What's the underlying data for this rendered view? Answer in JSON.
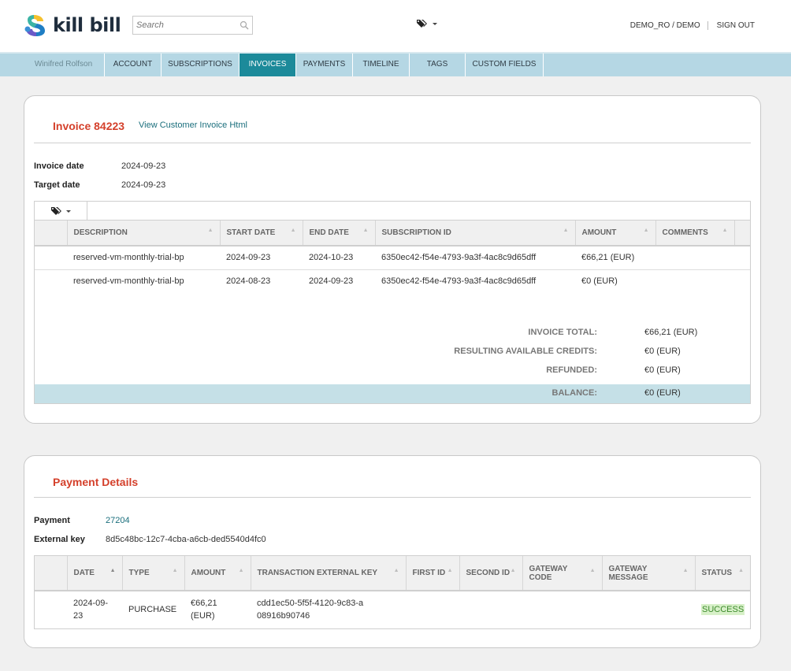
{
  "brand": {
    "name": "kill bill"
  },
  "search": {
    "placeholder": "Search",
    "value": ""
  },
  "header": {
    "user": "DEMO_RO / DEMO",
    "signout": "SIGN OUT"
  },
  "nav": {
    "account_name": "Winifred Rolfson",
    "tabs": [
      "ACCOUNT",
      "SUBSCRIPTIONS",
      "INVOICES",
      "PAYMENTS",
      "TIMELINE",
      "TAGS",
      "CUSTOM FIELDS"
    ],
    "active": "INVOICES"
  },
  "invoice": {
    "title": "Invoice 84223",
    "view_link": "View Customer Invoice Html",
    "invoice_date_label": "Invoice date",
    "invoice_date": "2024-09-23",
    "target_date_label": "Target date",
    "target_date": "2024-09-23",
    "columns": [
      "DESCRIPTION",
      "START DATE",
      "END DATE",
      "SUBSCRIPTION ID",
      "AMOUNT",
      "COMMENTS"
    ],
    "items": [
      {
        "description": "reserved-vm-monthly-trial-bp",
        "start": "2024-09-23",
        "end": "2024-10-23",
        "subscription_id": "6350ec42-f54e-4793-9a3f-4ac8c9d65dff",
        "amount": "€66,21 (EUR)",
        "comments": ""
      },
      {
        "description": "reserved-vm-monthly-trial-bp",
        "start": "2024-08-23",
        "end": "2024-09-23",
        "subscription_id": "6350ec42-f54e-4793-9a3f-4ac8c9d65dff",
        "amount": "€0 (EUR)",
        "comments": ""
      }
    ],
    "totals": {
      "total_label": "INVOICE TOTAL:",
      "total": "€66,21 (EUR)",
      "credits_label": "RESULTING AVAILABLE CREDITS:",
      "credits": "€0 (EUR)",
      "refunded_label": "REFUNDED:",
      "refunded": "€0 (EUR)",
      "balance_label": "BALANCE:",
      "balance": "€0 (EUR)"
    }
  },
  "payment": {
    "title": "Payment Details",
    "payment_label": "Payment",
    "payment_id": "27204",
    "external_key_label": "External key",
    "external_key": "8d5c48bc-12c7-4cba-a6cb-ded5540d4fc0",
    "columns": [
      "DATE",
      "TYPE",
      "AMOUNT",
      "TRANSACTION EXTERNAL KEY",
      "FIRST ID",
      "SECOND ID",
      "GATEWAY CODE",
      "GATEWAY MESSAGE",
      "STATUS"
    ],
    "transactions": [
      {
        "date": "2024-09-23",
        "type": "PURCHASE",
        "amount": "€66,21 (EUR)",
        "tx_key": "cdd1ec50-5f5f-4120-9c83-a08916b90746",
        "first_id": "",
        "second_id": "",
        "gateway_code": "",
        "gateway_message": "",
        "status": "SUCCESS"
      }
    ]
  },
  "colors": {
    "accent": "#1c8a9a",
    "nav_bg": "#b5d7e4",
    "title_red": "#d4402b",
    "balance_row": "#c5e0e7",
    "success_bg": "#d7f0c8"
  },
  "icons": [
    "search-icon",
    "tag-icon",
    "chevron-down-icon"
  ]
}
